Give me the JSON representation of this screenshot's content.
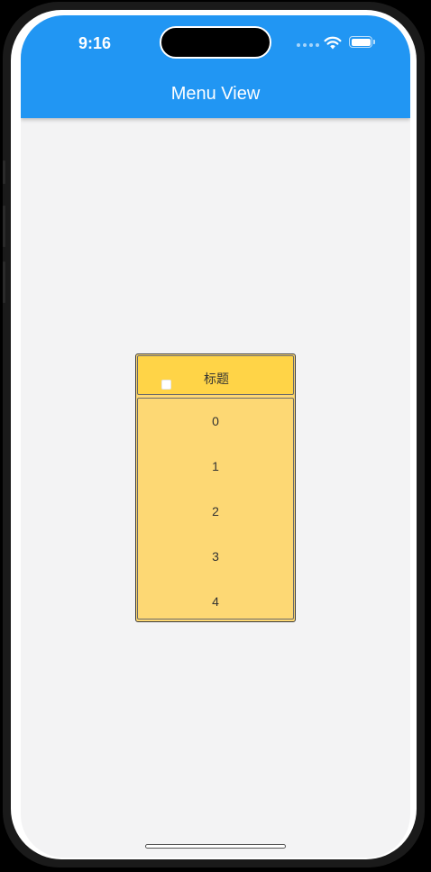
{
  "status_bar": {
    "time": "9:16",
    "icons": [
      "signal-dots-icon",
      "wifi-icon",
      "battery-icon"
    ]
  },
  "app_bar": {
    "title": "Menu View",
    "color": "#2196f3"
  },
  "menu": {
    "header_label": "标题",
    "header_color": "#ffd447",
    "list_color": "#fdd874",
    "items": [
      "0",
      "1",
      "2",
      "3",
      "4"
    ]
  }
}
